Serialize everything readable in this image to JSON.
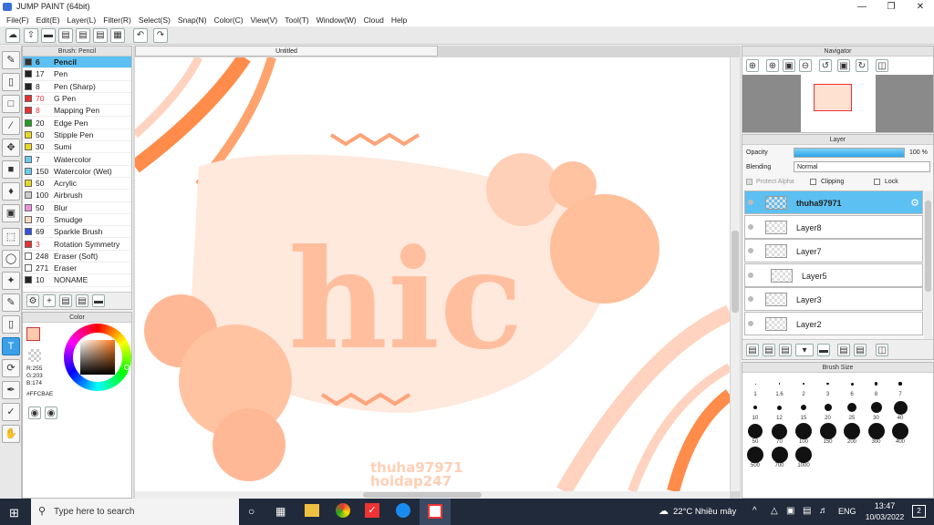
{
  "window": {
    "title": "JUMP PAINT (64bit)"
  },
  "menu": [
    "File(F)",
    "Edit(E)",
    "Layer(L)",
    "Filter(R)",
    "Select(S)",
    "Snap(N)",
    "Color(C)",
    "View(V)",
    "Tool(T)",
    "Window(W)",
    "Cloud",
    "Help"
  ],
  "brush_panel": {
    "title": "Brush: Pencil",
    "items": [
      {
        "size": "6",
        "name": "Pencil",
        "color": "#333333",
        "selected": true
      },
      {
        "size": "17",
        "name": "Pen",
        "color": "#222222"
      },
      {
        "size": "8",
        "name": "Pen (Sharp)",
        "color": "#222222"
      },
      {
        "size": "70",
        "name": "G Pen",
        "color": "#e83030"
      },
      {
        "size": "8",
        "name": "Mapping Pen",
        "color": "#e83030"
      },
      {
        "size": "20",
        "name": "Edge Pen",
        "color": "#22a022"
      },
      {
        "size": "50",
        "name": "Stipple Pen",
        "color": "#e8d820"
      },
      {
        "size": "30",
        "name": "Sumi",
        "color": "#e8d820"
      },
      {
        "size": "7",
        "name": "Watercolor",
        "color": "#66ccee"
      },
      {
        "size": "150",
        "name": "Watercolor (Wet)",
        "color": "#66ccee"
      },
      {
        "size": "50",
        "name": "Acrylic",
        "color": "#e8d820"
      },
      {
        "size": "100",
        "name": "Airbrush",
        "color": "#cccccc"
      },
      {
        "size": "50",
        "name": "Blur",
        "color": "#f090e0"
      },
      {
        "size": "70",
        "name": "Smudge",
        "color": "#f8d8c0"
      },
      {
        "size": "69",
        "name": "Sparkle Brush",
        "color": "#3050e0"
      },
      {
        "size": "3",
        "name": "Rotation Symmetry",
        "color": "#e83030"
      },
      {
        "size": "248",
        "name": "Eraser (Soft)",
        "color": "#ffffff"
      },
      {
        "size": "271",
        "name": "Eraser",
        "color": "#ffffff"
      },
      {
        "size": "10",
        "name": "NONAME",
        "color": "#222222"
      }
    ]
  },
  "color_panel": {
    "title": "Color",
    "current_color": "#FFCBAE",
    "r_label": "R:255",
    "g_label": "G:203",
    "b_label": "B:174",
    "hex_label": "#FFCBAE"
  },
  "document": {
    "tab": "Untitled"
  },
  "canvas": {
    "word": "hic",
    "watermark1": "thuha97971",
    "watermark2": "hoidap247"
  },
  "navigator": {
    "title": "Navigator"
  },
  "layer_panel": {
    "title": "Layer",
    "opacity_label": "Opacity",
    "opacity_value": "100 %",
    "opacity_fraction": 1.0,
    "blending_label": "Blending",
    "blending_value": "Normal",
    "protect_alpha": "Protect Alpha",
    "clipping": "Clipping",
    "lock": "Lock",
    "layers": [
      {
        "name": "thuha97971",
        "selected": true
      },
      {
        "name": "Layer8"
      },
      {
        "name": "Layer7"
      },
      {
        "name": "Layer5"
      },
      {
        "name": "Layer3"
      },
      {
        "name": "Layer2"
      }
    ]
  },
  "brush_size": {
    "title": "Brush Size",
    "sizes": [
      "1",
      "1.6",
      "2",
      "3",
      "6",
      "8",
      "7",
      "10",
      "12",
      "15",
      "20",
      "25",
      "30",
      "40",
      "50",
      "70",
      "100",
      "150",
      "200",
      "300",
      "400",
      "500",
      "700",
      "1000"
    ]
  },
  "taskbar": {
    "search_placeholder": "Type here to search",
    "weather": "22°C  Nhiều mây",
    "lang": "ENG",
    "time": "13:47",
    "date": "10/03/2022",
    "notifications": "2"
  }
}
